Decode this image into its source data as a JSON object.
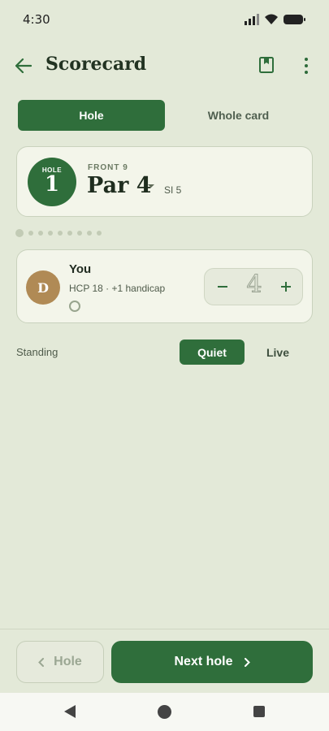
{
  "status_bar": {
    "time": "4:30"
  },
  "app_bar": {
    "title": "Scorecard"
  },
  "view_toggle": {
    "hole": "Hole",
    "whole_card": "Whole card"
  },
  "hole": {
    "badge_label": "HOLE",
    "number": "1",
    "section": "FRONT 9",
    "par": "Par 4",
    "stroke_index": "SI 5"
  },
  "pager": {
    "total": 9,
    "current": 1
  },
  "player": {
    "initial": "D",
    "name": "You",
    "handicap": "HCP 18 · +1 handicap",
    "score": "4",
    "avatar_color": "#b08a55"
  },
  "standing": {
    "label": "Standing",
    "modes": [
      "Quiet",
      "Live"
    ],
    "selected": "Quiet"
  },
  "footer": {
    "prev_label": "Hole",
    "next_label": "Next hole"
  },
  "colors": {
    "primary": "#2f6e3b",
    "background": "#e3e9d8",
    "card": "#f3f5ea"
  }
}
